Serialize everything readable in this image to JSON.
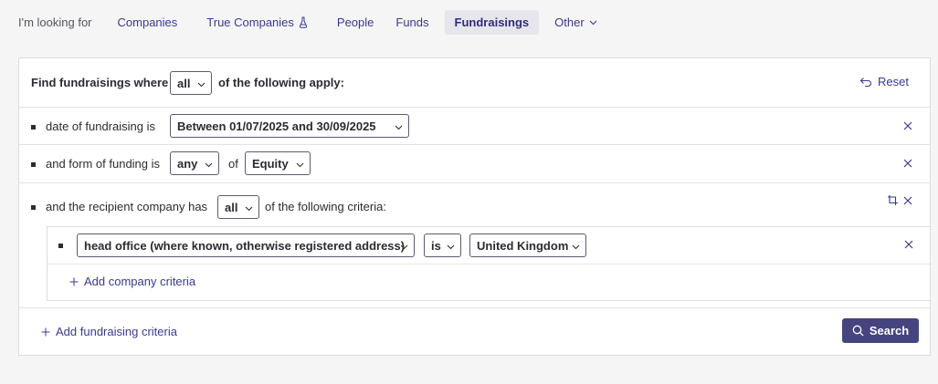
{
  "nav": {
    "lead": "I'm looking for",
    "tabs": [
      {
        "label": "Companies"
      },
      {
        "label": "True Companies"
      },
      {
        "label": "People"
      },
      {
        "label": "Funds"
      },
      {
        "label": "Fundraisings"
      },
      {
        "label": "Other"
      }
    ],
    "active_tab": "Fundraisings"
  },
  "query": {
    "intro": "Find fundraisings where",
    "match_mode": "all",
    "suffix": "of the following apply:",
    "reset_label": "Reset"
  },
  "criteria": [
    {
      "label": "date of fundraising is",
      "value": "Between 01/07/2025 and 30/09/2025"
    },
    {
      "label": "and form of funding is",
      "qualifier": "any",
      "connector": "of",
      "value": "Equity"
    },
    {
      "label": "and the recipient company has",
      "qualifier": "all",
      "suffix": "of the following criteria:"
    }
  ],
  "company_criteria": [
    {
      "field": "head office (where known, otherwise registered address)",
      "operator": "is",
      "value": "United Kingdom"
    }
  ],
  "add_company_label": "Add company criteria",
  "add_fundraising_label": "Add fundraising criteria",
  "search_label": "Search",
  "colors": {
    "accent": "#3b3a8c",
    "button": "#46447e",
    "border": "#dcdce1"
  }
}
